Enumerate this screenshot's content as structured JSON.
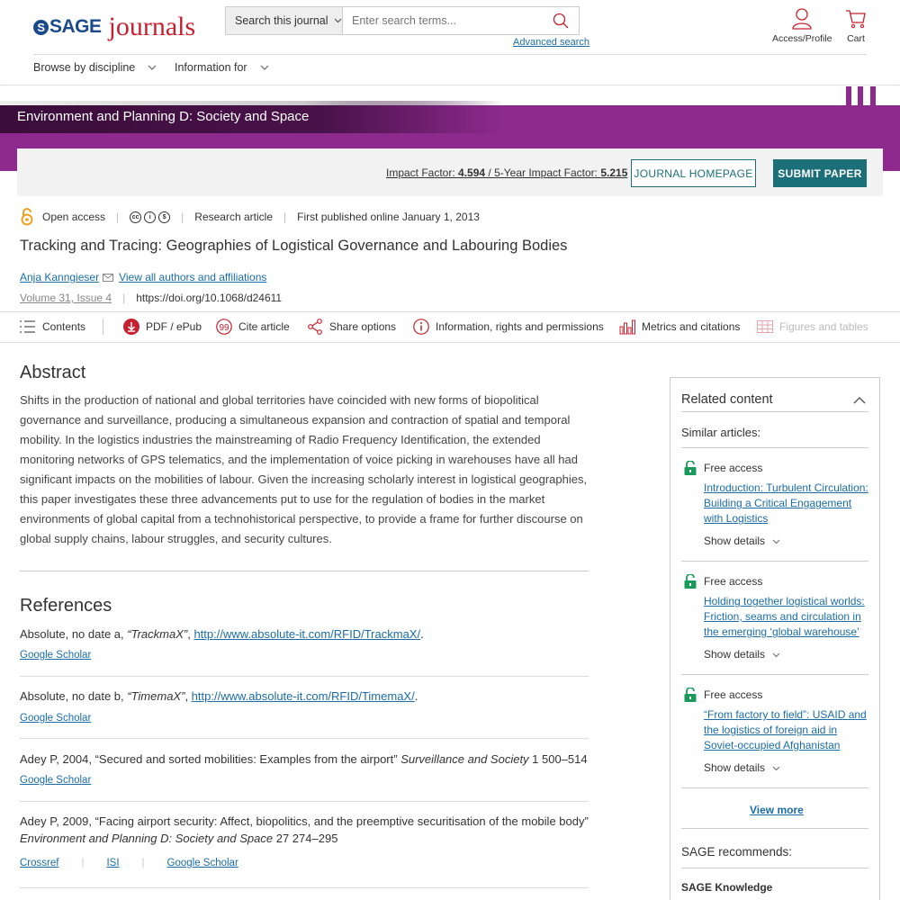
{
  "header": {
    "logo_sage": "SAGE",
    "logo_journals": "journals",
    "search_scope": "Search this journal",
    "search_placeholder": "Enter search terms...",
    "advanced_search": "Advanced search",
    "access_profile": "Access/Profile",
    "cart": "Cart",
    "nav": [
      {
        "label": "Browse by discipline"
      },
      {
        "label": "Information for"
      }
    ]
  },
  "journal": {
    "name": "Environment and Planning D: Society and Space",
    "impact_label": "Impact Factor: ",
    "impact_value": "4.594",
    "impact_sep": " / ",
    "five_year_label": "5-Year Impact Factor: ",
    "five_year_value": "5.215",
    "homepage_button": "JOURNAL HOMEPAGE",
    "submit_button": "SUBMIT PAPER",
    "brand_color": "#8e2a8e",
    "accent_color": "#1b6f78"
  },
  "article": {
    "access": "Open access",
    "type": "Research article",
    "published": "First published online January 1, 2013",
    "title": "Tracking and Tracing: Geographies of Logistical Governance and Labouring Bodies",
    "author": "Anja Kanngieser",
    "all_authors": "View all authors and affiliations",
    "volume": "Volume 31, Issue 4",
    "doi": "https://doi.org/10.1068/d24611"
  },
  "toolbar": {
    "contents": "Contents",
    "pdf": "PDF / ePub",
    "cite": "Cite article",
    "share": "Share options",
    "info": "Information, rights and permissions",
    "metrics": "Metrics and citations",
    "figures": "Figures and tables"
  },
  "abstract": {
    "heading": "Abstract",
    "text": "Shifts in the production of national and global territories have coincided with new forms of biopolitical governance and surveillance, producing a simultaneous expansion and contraction of spatial and temporal mobility. In the logistics industries the mainstreaming of Radio Frequency Identification, the extended monitoring networks of GPS telematics, and the implementation of voice picking in warehouses have all had significant impacts on the mobilities of labour. Given the increasing scholarly interest in logistical geographies, this paper investigates these three advancements put to use for the regulation of bodies in the market environments of global capital from a technohistorical perspective, to provide a frame for further discourse on global supply chains, labour struggles, and security cultures."
  },
  "references": {
    "heading": "References",
    "items": [
      {
        "pre": "Absolute, no date a, ",
        "italic": "“TrackmaX”",
        "mid": ", ",
        "url": "http://www.absolute-it.com/RFID/TrackmaX/",
        "post": ".",
        "links": [
          "Google Scholar"
        ]
      },
      {
        "pre": "Absolute, no date b, ",
        "italic": "“TimemaX”",
        "mid": ", ",
        "url": "http://www.absolute-it.com/RFID/TimemaX/",
        "post": ".",
        "links": [
          "Google Scholar"
        ]
      },
      {
        "pre": "Adey P, 2004, “Secured and sorted mobilities: Examples from the airport” ",
        "italic": "Surveillance and Society",
        "post": " 1 500–514",
        "links": [
          "Google Scholar"
        ]
      },
      {
        "pre": "Adey P, 2009, “Facing airport security: Affect, biopolitics, and the preemptive securitisation of the mobile body” ",
        "italic": "Environment and Planning D: Society and Space",
        "post": " 27 274–295",
        "links": [
          "Crossref",
          "ISI",
          "Google Scholar"
        ]
      }
    ]
  },
  "related": {
    "heading": "Related content",
    "similar": "Similar articles:",
    "items": [
      {
        "access": "Free access",
        "title": "Introduction: Turbulent Circulation: Building a Critical Engagement with Logistics",
        "details": "Show details"
      },
      {
        "access": "Free access",
        "title": "Holding together logistical worlds: Friction, seams and circulation in the emerging ‘global warehouse’",
        "details": "Show details"
      },
      {
        "access": "Free access",
        "title": "“From factory to field”: USAID and the logistics of foreign aid in Soviet-occupied Afghanistan",
        "details": "Show details"
      }
    ],
    "view_more": "View more",
    "sage_recommends": "SAGE recommends:",
    "sage_knowledge": "SAGE Knowledge"
  }
}
